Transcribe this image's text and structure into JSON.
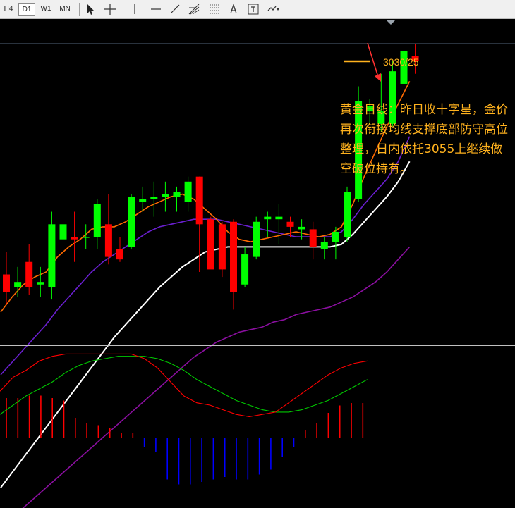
{
  "toolbar": {
    "timeframes": [
      {
        "label": "H4",
        "active": false
      },
      {
        "label": "D1",
        "active": true
      },
      {
        "label": "W1",
        "active": false
      },
      {
        "label": "MN",
        "active": false
      }
    ],
    "tools": [
      "cursor-icon",
      "crosshair-icon",
      "vertical-line-icon",
      "horizontal-line-icon",
      "trendline-icon",
      "fibonacci-fan-icon",
      "fibonacci-retracement-icon",
      "text-icon",
      "text-label-icon",
      "shapes-dropdown-icon"
    ]
  },
  "annotation_text": "黄金日线：昨日收十字星，金价再次衔接均线支撑底部防守高位整理，日内依托3055上继续做空破位持有。",
  "target_label": "3030/25",
  "colors": {
    "background": "#000000",
    "bull_candle": "#00ff00",
    "bear_candle": "#ff0000",
    "ma_fast": "#ff6a00",
    "ma_medium": "#6a1fd0",
    "ma_slow": "#ffffff",
    "ma_long": "#8b0fa0",
    "annotation": "#ffb21e",
    "macd_red": "#ff0000",
    "macd_blue": "#0000ff",
    "signal_green": "#00c800"
  },
  "chart_data": {
    "type": "candlestick",
    "candles": [
      {
        "o": 2975,
        "h": 2984,
        "l": 2963,
        "c": 2968
      },
      {
        "o": 2970,
        "h": 2978,
        "l": 2966,
        "c": 2972
      },
      {
        "o": 2980,
        "h": 2987,
        "l": 2967,
        "c": 2970
      },
      {
        "o": 2971,
        "h": 2978,
        "l": 2966,
        "c": 2972
      },
      {
        "o": 2970,
        "h": 3000,
        "l": 2965,
        "c": 2995
      },
      {
        "o": 2989,
        "h": 3007,
        "l": 2984,
        "c": 2995
      },
      {
        "o": 2990,
        "h": 3000,
        "l": 2980,
        "c": 2989
      },
      {
        "o": 2990,
        "h": 2995,
        "l": 2985,
        "c": 2990
      },
      {
        "o": 2990,
        "h": 3005,
        "l": 2985,
        "c": 3003
      },
      {
        "o": 2995,
        "h": 3007,
        "l": 2979,
        "c": 2982
      },
      {
        "o": 2985,
        "h": 2990,
        "l": 2980,
        "c": 2981
      },
      {
        "o": 2986,
        "h": 3007,
        "l": 2985,
        "c": 3006
      },
      {
        "o": 3004,
        "h": 3010,
        "l": 3000,
        "c": 3005
      },
      {
        "o": 3005,
        "h": 3012,
        "l": 2998,
        "c": 3006
      },
      {
        "o": 3006,
        "h": 3012,
        "l": 3000,
        "c": 3007
      },
      {
        "o": 3006,
        "h": 3010,
        "l": 3000,
        "c": 3008
      },
      {
        "o": 3004,
        "h": 3014,
        "l": 3000,
        "c": 3012
      },
      {
        "o": 3014,
        "h": 3014,
        "l": 2976,
        "c": 2995
      },
      {
        "o": 2997,
        "h": 2998,
        "l": 2979,
        "c": 2977
      },
      {
        "o": 2995,
        "h": 2996,
        "l": 2974,
        "c": 2977
      },
      {
        "o": 2996,
        "h": 2997,
        "l": 2961,
        "c": 2968
      },
      {
        "o": 2971,
        "h": 2986,
        "l": 2970,
        "c": 2983
      },
      {
        "o": 2982,
        "h": 2998,
        "l": 2981,
        "c": 2996
      },
      {
        "o": 2997,
        "h": 3000,
        "l": 2990,
        "c": 2998
      },
      {
        "o": 2997,
        "h": 3003,
        "l": 2987,
        "c": 2998
      },
      {
        "o": 2996,
        "h": 2998,
        "l": 2990,
        "c": 2994
      },
      {
        "o": 2993,
        "h": 2997,
        "l": 2989,
        "c": 2994
      },
      {
        "o": 2993,
        "h": 2996,
        "l": 2981,
        "c": 2986
      },
      {
        "o": 2985,
        "h": 2990,
        "l": 2981,
        "c": 2988
      },
      {
        "o": 2988,
        "h": 2994,
        "l": 2981,
        "c": 2992
      },
      {
        "o": 2990,
        "h": 3010,
        "l": 2988,
        "c": 3008
      },
      {
        "o": 3005,
        "h": 3050,
        "l": 3004,
        "c": 3044
      },
      {
        "o": 3040,
        "h": 3045,
        "l": 3035,
        "c": 3042
      },
      {
        "o": 3035,
        "h": 3055,
        "l": 3032,
        "c": 3040
      },
      {
        "o": 3035,
        "h": 3060,
        "l": 3034,
        "c": 3056
      },
      {
        "o": 3051,
        "h": 3063,
        "l": 3045,
        "c": 3064
      },
      {
        "o": 3062,
        "h": 3067,
        "l": 3055,
        "c": 3060
      }
    ],
    "ma_fast": [
      2960,
      2966,
      2971,
      2974,
      2976,
      2982,
      2986,
      2989,
      2993,
      2994,
      2994,
      2996,
      2999,
      3002,
      3004,
      3006,
      3007,
      3005,
      3001,
      2997,
      2992,
      2989,
      2988,
      2989,
      2990,
      2991,
      2992,
      2991,
      2990,
      2991,
      2994,
      3003,
      3014,
      3024,
      3034,
      3043,
      3052
    ],
    "ma_medium": [
      2935,
      2940,
      2945,
      2950,
      2955,
      2961,
      2966,
      2971,
      2976,
      2980,
      2983,
      2986,
      2989,
      2992,
      2994,
      2995,
      2996,
      2997,
      2997,
      2997,
      2996,
      2995,
      2994,
      2993,
      2992,
      2991,
      2990,
      2990,
      2990,
      2990,
      2992,
      2997,
      3003,
      3008,
      3013,
      3020,
      3030
    ],
    "ma_slow": [
      2890,
      2896,
      2902,
      2908,
      2914,
      2920,
      2926,
      2932,
      2938,
      2944,
      2950,
      2955,
      2960,
      2965,
      2970,
      2974,
      2978,
      2981,
      2984,
      2985,
      2986,
      2986,
      2986,
      2986,
      2986,
      2986,
      2986,
      2986,
      2986,
      2986,
      2987,
      2991,
      2996,
      3001,
      3006,
      3012,
      3020
    ],
    "ma_long": [
      2875,
      2878,
      2882,
      2886,
      2890,
      2894,
      2898,
      2902,
      2906,
      2910,
      2914,
      2918,
      2922,
      2926,
      2930,
      2934,
      2938,
      2942,
      2945,
      2948,
      2950,
      2952,
      2953,
      2954,
      2956,
      2957,
      2959,
      2960,
      2961,
      2962,
      2964,
      2966,
      2969,
      2972,
      2976,
      2981,
      2986
    ],
    "macd_hist": [
      16,
      16,
      17,
      17,
      16,
      15,
      8,
      6,
      5,
      4,
      2,
      2,
      -4,
      -6,
      -17,
      -19,
      -19,
      -18,
      -17,
      -16,
      -17,
      -17,
      -15,
      -13,
      -8,
      -4,
      3,
      6,
      10,
      13,
      14,
      14
    ],
    "macd_line": [
      -4,
      2,
      5,
      9,
      11,
      12,
      12,
      12,
      12,
      12,
      12,
      10,
      6,
      0,
      -6,
      -9,
      -10,
      -12,
      -14,
      -15,
      -14,
      -13,
      -9,
      -5,
      -1,
      3,
      6,
      8,
      9
    ],
    "signal_line": [
      -14,
      -10,
      -6,
      -3,
      0,
      4,
      7,
      9,
      10,
      11,
      11,
      11,
      10,
      8,
      5,
      1,
      -2,
      -5,
      -8,
      -10,
      -12,
      -13,
      -13,
      -12,
      -10,
      -8,
      -5,
      -2,
      1
    ]
  }
}
